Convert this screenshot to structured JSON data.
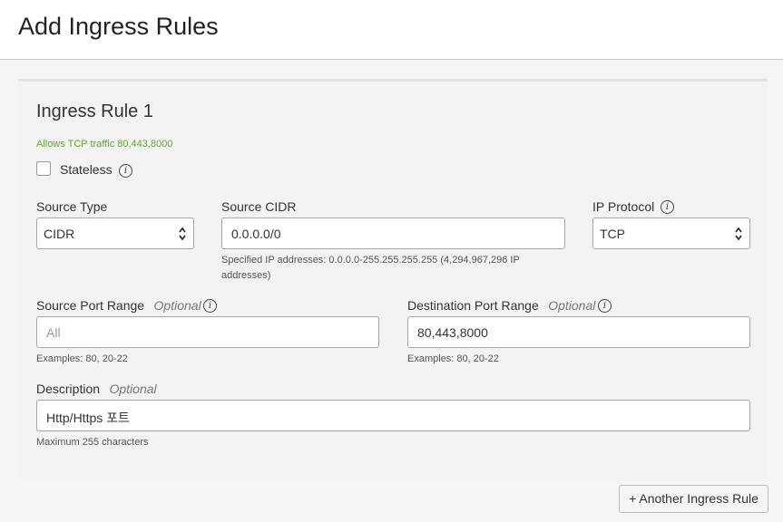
{
  "page": {
    "title": "Add Ingress Rules"
  },
  "rule": {
    "title": "Ingress Rule 1",
    "summary": "Allows TCP traffic 80,443,8000",
    "stateless_label": "Stateless",
    "stateless_checked": false
  },
  "source_type": {
    "label": "Source Type",
    "value": "CIDR"
  },
  "source_cidr": {
    "label": "Source CIDR",
    "value": "0.0.0.0/0",
    "help_line1": "Specified IP addresses: 0.0.0.0-255.255.255.255 (4,294,967,296 IP",
    "help_line2": "addresses)"
  },
  "ip_protocol": {
    "label": "IP Protocol",
    "value": "TCP"
  },
  "source_port_range": {
    "label": "Source Port Range",
    "optional": "Optional",
    "placeholder": "All",
    "help": "Examples: 80, 20-22"
  },
  "destination_port_range": {
    "label": "Destination Port Range",
    "optional": "Optional",
    "value": "80,443,8000",
    "help": "Examples: 80, 20-22"
  },
  "description": {
    "label": "Description",
    "optional": "Optional",
    "value": "Http/Https 포트",
    "help": "Maximum 255 characters"
  },
  "info_icon_glyph": "i",
  "actions": {
    "another_rule": "+ Another Ingress Rule"
  },
  "icons": {
    "info": "info-circle-icon",
    "select": "up-down-chevron-icon"
  },
  "colors": {
    "summary_green": "#5da82c"
  }
}
